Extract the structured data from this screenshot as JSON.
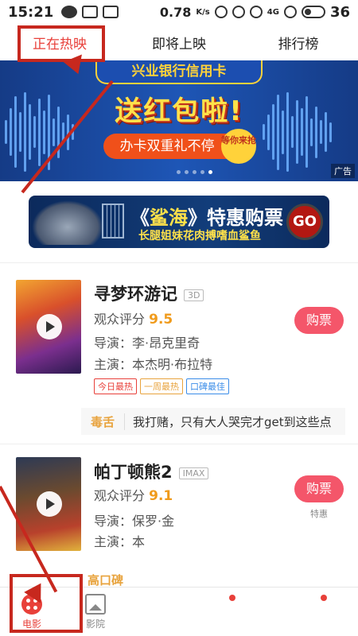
{
  "status_bar": {
    "time": "15:21",
    "speed": "0.78",
    "speed_unit": "K/s",
    "network": "4G",
    "battery": "36"
  },
  "top_tabs": [
    {
      "label": "正在热映",
      "active": true
    },
    {
      "label": "即将上映",
      "active": false
    },
    {
      "label": "排行榜",
      "active": false
    }
  ],
  "banner": {
    "header": "兴业银行信用卡",
    "headline": "送红包啦!",
    "sub_text": "办卡双重礼不停",
    "badge": "等你来抢",
    "ad_label": "广告",
    "dots_count": 5,
    "active_dot": 4
  },
  "promo": {
    "title": "《鲨海》特惠购票",
    "title_highlight": "鲨海",
    "subtitle": "长腿姐妹花肉搏嗜血鲨鱼",
    "go_label": "GO"
  },
  "movies": [
    {
      "title": "寻梦环游记",
      "format": "3D",
      "rating_label": "观众评分",
      "rating": "9.5",
      "director_label": "导演：",
      "director": "李·昂克里奇",
      "cast_label": "主演：",
      "cast": "本杰明·布拉特",
      "tags": [
        {
          "text": "今日最热",
          "color": "#e8403a"
        },
        {
          "text": "一周最热",
          "color": "#e8a33d"
        },
        {
          "text": "口碑最佳",
          "color": "#3a8ce8"
        }
      ],
      "buy_label": "购票",
      "buy_sub": ""
    },
    {
      "title": "帕丁顿熊2",
      "format": "IMAX",
      "rating_label": "观众评分",
      "rating": "9.1",
      "director_label": "导演：",
      "director": "保罗·金",
      "cast_label": "主演：",
      "cast": "本",
      "tags": [],
      "buy_label": "购票",
      "buy_sub": "特惠"
    }
  ],
  "review": {
    "label": "毒舌",
    "text": "我打赌，只有大人哭完才get到这些点"
  },
  "hot_label": "高口碑",
  "bottom_nav": [
    {
      "label": "电影",
      "icon": "film-icon",
      "active": true
    },
    {
      "label": "影院",
      "icon": "picture-icon",
      "active": false
    },
    {
      "label": "",
      "icon": "dot-icon",
      "active": false
    },
    {
      "label": "",
      "icon": "dot-icon",
      "active": false
    },
    {
      "label": "",
      "icon": "dot-icon",
      "active": false
    }
  ],
  "colors": {
    "accent": "#e8403a",
    "annotation": "#c7281e",
    "buy_button": "#f4566a",
    "rating": "#f09b1c"
  }
}
